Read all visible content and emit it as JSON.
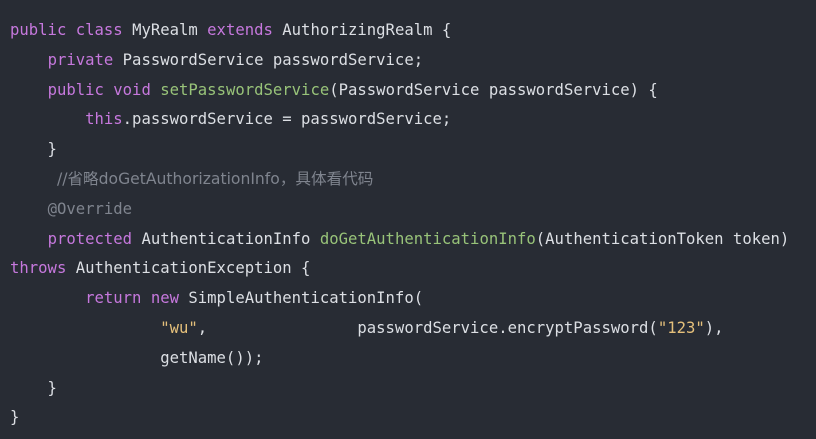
{
  "code": {
    "language": "java",
    "lines": [
      [
        {
          "t": "kw",
          "v": "public class "
        },
        {
          "t": "tx",
          "v": "MyRealm "
        },
        {
          "t": "kw",
          "v": "extends "
        },
        {
          "t": "tx",
          "v": "AuthorizingRealm {"
        }
      ],
      [
        {
          "t": "tx",
          "v": "    "
        },
        {
          "t": "kw",
          "v": "private "
        },
        {
          "t": "tx",
          "v": "PasswordService passwordService;"
        }
      ],
      [
        {
          "t": "tx",
          "v": "    "
        },
        {
          "t": "kw",
          "v": "public void "
        },
        {
          "t": "fn",
          "v": "setPasswordService"
        },
        {
          "t": "tx",
          "v": "(PasswordService passwordService) {"
        }
      ],
      [
        {
          "t": "tx",
          "v": "        "
        },
        {
          "t": "kw",
          "v": "this"
        },
        {
          "t": "tx",
          "v": ".passwordService = passwordService;"
        }
      ],
      [
        {
          "t": "tx",
          "v": "    }"
        }
      ],
      [
        {
          "t": "tx",
          "v": "     "
        },
        {
          "t": "cm",
          "v": "//省略doGetAuthorizationInfo，具体看代码"
        }
      ],
      [
        {
          "t": "tx",
          "v": "    "
        },
        {
          "t": "an",
          "v": "@Override"
        }
      ],
      [
        {
          "t": "tx",
          "v": "    "
        },
        {
          "t": "kw",
          "v": "protected "
        },
        {
          "t": "tx",
          "v": "AuthenticationInfo "
        },
        {
          "t": "fn",
          "v": "doGetAuthenticationInfo"
        },
        {
          "t": "tx",
          "v": "(AuthenticationToken token)"
        }
      ],
      [
        {
          "t": "kw",
          "v": "throws "
        },
        {
          "t": "tx",
          "v": "AuthenticationException {"
        }
      ],
      [
        {
          "t": "tx",
          "v": "        "
        },
        {
          "t": "kw",
          "v": "return new "
        },
        {
          "t": "tx",
          "v": "SimpleAuthenticationInfo("
        }
      ],
      [
        {
          "t": "tx",
          "v": "                "
        },
        {
          "t": "st",
          "v": "\"wu\""
        },
        {
          "t": "tx",
          "v": ",                passwordService.encryptPassword("
        },
        {
          "t": "st",
          "v": "\"123\""
        },
        {
          "t": "tx",
          "v": "),"
        }
      ],
      [
        {
          "t": "tx",
          "v": "                getName());"
        }
      ],
      [
        {
          "t": "tx",
          "v": "    }"
        }
      ],
      [
        {
          "t": "tx",
          "v": "}"
        }
      ]
    ]
  },
  "colors": {
    "background": "#282c34",
    "keyword": "#c678dd",
    "function": "#98c379",
    "comment": "#7f848e",
    "string": "#e5c07b",
    "text": "#dcdfe4"
  }
}
